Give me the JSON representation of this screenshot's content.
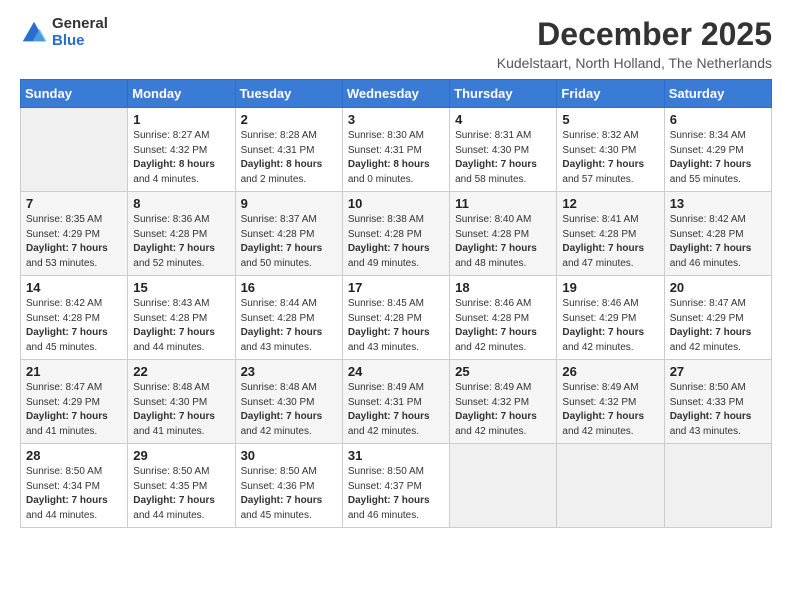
{
  "logo": {
    "general": "General",
    "blue": "Blue"
  },
  "title": "December 2025",
  "location": "Kudelstaart, North Holland, The Netherlands",
  "days_of_week": [
    "Sunday",
    "Monday",
    "Tuesday",
    "Wednesday",
    "Thursday",
    "Friday",
    "Saturday"
  ],
  "weeks": [
    [
      {
        "num": "",
        "info": ""
      },
      {
        "num": "1",
        "info": "Sunrise: 8:27 AM\nSunset: 4:32 PM\nDaylight: 8 hours\nand 4 minutes."
      },
      {
        "num": "2",
        "info": "Sunrise: 8:28 AM\nSunset: 4:31 PM\nDaylight: 8 hours\nand 2 minutes."
      },
      {
        "num": "3",
        "info": "Sunrise: 8:30 AM\nSunset: 4:31 PM\nDaylight: 8 hours\nand 0 minutes."
      },
      {
        "num": "4",
        "info": "Sunrise: 8:31 AM\nSunset: 4:30 PM\nDaylight: 7 hours\nand 58 minutes."
      },
      {
        "num": "5",
        "info": "Sunrise: 8:32 AM\nSunset: 4:30 PM\nDaylight: 7 hours\nand 57 minutes."
      },
      {
        "num": "6",
        "info": "Sunrise: 8:34 AM\nSunset: 4:29 PM\nDaylight: 7 hours\nand 55 minutes."
      }
    ],
    [
      {
        "num": "7",
        "info": "Sunrise: 8:35 AM\nSunset: 4:29 PM\nDaylight: 7 hours\nand 53 minutes."
      },
      {
        "num": "8",
        "info": "Sunrise: 8:36 AM\nSunset: 4:28 PM\nDaylight: 7 hours\nand 52 minutes."
      },
      {
        "num": "9",
        "info": "Sunrise: 8:37 AM\nSunset: 4:28 PM\nDaylight: 7 hours\nand 50 minutes."
      },
      {
        "num": "10",
        "info": "Sunrise: 8:38 AM\nSunset: 4:28 PM\nDaylight: 7 hours\nand 49 minutes."
      },
      {
        "num": "11",
        "info": "Sunrise: 8:40 AM\nSunset: 4:28 PM\nDaylight: 7 hours\nand 48 minutes."
      },
      {
        "num": "12",
        "info": "Sunrise: 8:41 AM\nSunset: 4:28 PM\nDaylight: 7 hours\nand 47 minutes."
      },
      {
        "num": "13",
        "info": "Sunrise: 8:42 AM\nSunset: 4:28 PM\nDaylight: 7 hours\nand 46 minutes."
      }
    ],
    [
      {
        "num": "14",
        "info": "Sunrise: 8:42 AM\nSunset: 4:28 PM\nDaylight: 7 hours\nand 45 minutes."
      },
      {
        "num": "15",
        "info": "Sunrise: 8:43 AM\nSunset: 4:28 PM\nDaylight: 7 hours\nand 44 minutes."
      },
      {
        "num": "16",
        "info": "Sunrise: 8:44 AM\nSunset: 4:28 PM\nDaylight: 7 hours\nand 43 minutes."
      },
      {
        "num": "17",
        "info": "Sunrise: 8:45 AM\nSunset: 4:28 PM\nDaylight: 7 hours\nand 43 minutes."
      },
      {
        "num": "18",
        "info": "Sunrise: 8:46 AM\nSunset: 4:28 PM\nDaylight: 7 hours\nand 42 minutes."
      },
      {
        "num": "19",
        "info": "Sunrise: 8:46 AM\nSunset: 4:29 PM\nDaylight: 7 hours\nand 42 minutes."
      },
      {
        "num": "20",
        "info": "Sunrise: 8:47 AM\nSunset: 4:29 PM\nDaylight: 7 hours\nand 42 minutes."
      }
    ],
    [
      {
        "num": "21",
        "info": "Sunrise: 8:47 AM\nSunset: 4:29 PM\nDaylight: 7 hours\nand 41 minutes."
      },
      {
        "num": "22",
        "info": "Sunrise: 8:48 AM\nSunset: 4:30 PM\nDaylight: 7 hours\nand 41 minutes."
      },
      {
        "num": "23",
        "info": "Sunrise: 8:48 AM\nSunset: 4:30 PM\nDaylight: 7 hours\nand 42 minutes."
      },
      {
        "num": "24",
        "info": "Sunrise: 8:49 AM\nSunset: 4:31 PM\nDaylight: 7 hours\nand 42 minutes."
      },
      {
        "num": "25",
        "info": "Sunrise: 8:49 AM\nSunset: 4:32 PM\nDaylight: 7 hours\nand 42 minutes."
      },
      {
        "num": "26",
        "info": "Sunrise: 8:49 AM\nSunset: 4:32 PM\nDaylight: 7 hours\nand 42 minutes."
      },
      {
        "num": "27",
        "info": "Sunrise: 8:50 AM\nSunset: 4:33 PM\nDaylight: 7 hours\nand 43 minutes."
      }
    ],
    [
      {
        "num": "28",
        "info": "Sunrise: 8:50 AM\nSunset: 4:34 PM\nDaylight: 7 hours\nand 44 minutes."
      },
      {
        "num": "29",
        "info": "Sunrise: 8:50 AM\nSunset: 4:35 PM\nDaylight: 7 hours\nand 44 minutes."
      },
      {
        "num": "30",
        "info": "Sunrise: 8:50 AM\nSunset: 4:36 PM\nDaylight: 7 hours\nand 45 minutes."
      },
      {
        "num": "31",
        "info": "Sunrise: 8:50 AM\nSunset: 4:37 PM\nDaylight: 7 hours\nand 46 minutes."
      },
      {
        "num": "",
        "info": ""
      },
      {
        "num": "",
        "info": ""
      },
      {
        "num": "",
        "info": ""
      }
    ]
  ]
}
